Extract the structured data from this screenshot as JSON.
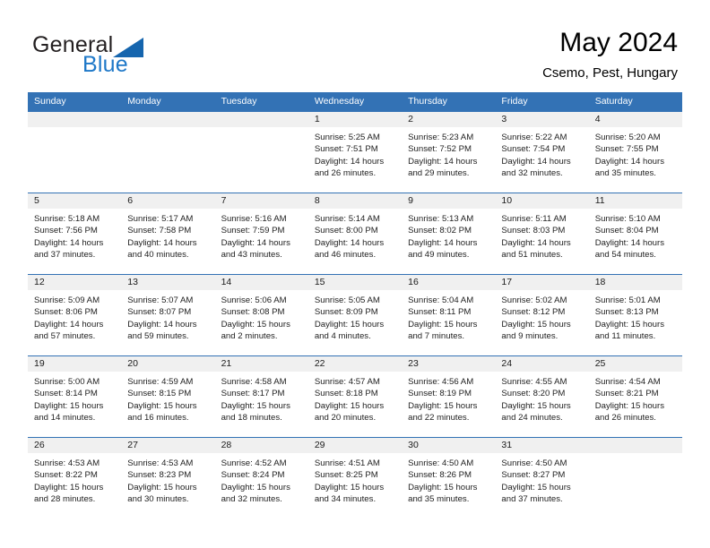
{
  "brand": {
    "name_part1": "General",
    "name_part2": "Blue",
    "logo_icon": "triangle-logo-icon"
  },
  "header": {
    "title": "May 2024",
    "location": "Csemo, Pest, Hungary"
  },
  "colors": {
    "header_blue": "#3372b5",
    "brand_blue": "#1e78c8",
    "logo_blue": "#1565ae",
    "daynum_band": "#f0f0f0"
  },
  "weekdays": [
    "Sunday",
    "Monday",
    "Tuesday",
    "Wednesday",
    "Thursday",
    "Friday",
    "Saturday"
  ],
  "weeks": [
    [
      {
        "day": "",
        "sunrise": "",
        "sunset": "",
        "daylight_line1": "",
        "daylight_line2": "",
        "empty": true
      },
      {
        "day": "",
        "sunrise": "",
        "sunset": "",
        "daylight_line1": "",
        "daylight_line2": "",
        "empty": true
      },
      {
        "day": "",
        "sunrise": "",
        "sunset": "",
        "daylight_line1": "",
        "daylight_line2": "",
        "empty": true
      },
      {
        "day": "1",
        "sunrise": "Sunrise: 5:25 AM",
        "sunset": "Sunset: 7:51 PM",
        "daylight_line1": "Daylight: 14 hours",
        "daylight_line2": "and 26 minutes.",
        "empty": false
      },
      {
        "day": "2",
        "sunrise": "Sunrise: 5:23 AM",
        "sunset": "Sunset: 7:52 PM",
        "daylight_line1": "Daylight: 14 hours",
        "daylight_line2": "and 29 minutes.",
        "empty": false
      },
      {
        "day": "3",
        "sunrise": "Sunrise: 5:22 AM",
        "sunset": "Sunset: 7:54 PM",
        "daylight_line1": "Daylight: 14 hours",
        "daylight_line2": "and 32 minutes.",
        "empty": false
      },
      {
        "day": "4",
        "sunrise": "Sunrise: 5:20 AM",
        "sunset": "Sunset: 7:55 PM",
        "daylight_line1": "Daylight: 14 hours",
        "daylight_line2": "and 35 minutes.",
        "empty": false
      }
    ],
    [
      {
        "day": "5",
        "sunrise": "Sunrise: 5:18 AM",
        "sunset": "Sunset: 7:56 PM",
        "daylight_line1": "Daylight: 14 hours",
        "daylight_line2": "and 37 minutes.",
        "empty": false
      },
      {
        "day": "6",
        "sunrise": "Sunrise: 5:17 AM",
        "sunset": "Sunset: 7:58 PM",
        "daylight_line1": "Daylight: 14 hours",
        "daylight_line2": "and 40 minutes.",
        "empty": false
      },
      {
        "day": "7",
        "sunrise": "Sunrise: 5:16 AM",
        "sunset": "Sunset: 7:59 PM",
        "daylight_line1": "Daylight: 14 hours",
        "daylight_line2": "and 43 minutes.",
        "empty": false
      },
      {
        "day": "8",
        "sunrise": "Sunrise: 5:14 AM",
        "sunset": "Sunset: 8:00 PM",
        "daylight_line1": "Daylight: 14 hours",
        "daylight_line2": "and 46 minutes.",
        "empty": false
      },
      {
        "day": "9",
        "sunrise": "Sunrise: 5:13 AM",
        "sunset": "Sunset: 8:02 PM",
        "daylight_line1": "Daylight: 14 hours",
        "daylight_line2": "and 49 minutes.",
        "empty": false
      },
      {
        "day": "10",
        "sunrise": "Sunrise: 5:11 AM",
        "sunset": "Sunset: 8:03 PM",
        "daylight_line1": "Daylight: 14 hours",
        "daylight_line2": "and 51 minutes.",
        "empty": false
      },
      {
        "day": "11",
        "sunrise": "Sunrise: 5:10 AM",
        "sunset": "Sunset: 8:04 PM",
        "daylight_line1": "Daylight: 14 hours",
        "daylight_line2": "and 54 minutes.",
        "empty": false
      }
    ],
    [
      {
        "day": "12",
        "sunrise": "Sunrise: 5:09 AM",
        "sunset": "Sunset: 8:06 PM",
        "daylight_line1": "Daylight: 14 hours",
        "daylight_line2": "and 57 minutes.",
        "empty": false
      },
      {
        "day": "13",
        "sunrise": "Sunrise: 5:07 AM",
        "sunset": "Sunset: 8:07 PM",
        "daylight_line1": "Daylight: 14 hours",
        "daylight_line2": "and 59 minutes.",
        "empty": false
      },
      {
        "day": "14",
        "sunrise": "Sunrise: 5:06 AM",
        "sunset": "Sunset: 8:08 PM",
        "daylight_line1": "Daylight: 15 hours",
        "daylight_line2": "and 2 minutes.",
        "empty": false
      },
      {
        "day": "15",
        "sunrise": "Sunrise: 5:05 AM",
        "sunset": "Sunset: 8:09 PM",
        "daylight_line1": "Daylight: 15 hours",
        "daylight_line2": "and 4 minutes.",
        "empty": false
      },
      {
        "day": "16",
        "sunrise": "Sunrise: 5:04 AM",
        "sunset": "Sunset: 8:11 PM",
        "daylight_line1": "Daylight: 15 hours",
        "daylight_line2": "and 7 minutes.",
        "empty": false
      },
      {
        "day": "17",
        "sunrise": "Sunrise: 5:02 AM",
        "sunset": "Sunset: 8:12 PM",
        "daylight_line1": "Daylight: 15 hours",
        "daylight_line2": "and 9 minutes.",
        "empty": false
      },
      {
        "day": "18",
        "sunrise": "Sunrise: 5:01 AM",
        "sunset": "Sunset: 8:13 PM",
        "daylight_line1": "Daylight: 15 hours",
        "daylight_line2": "and 11 minutes.",
        "empty": false
      }
    ],
    [
      {
        "day": "19",
        "sunrise": "Sunrise: 5:00 AM",
        "sunset": "Sunset: 8:14 PM",
        "daylight_line1": "Daylight: 15 hours",
        "daylight_line2": "and 14 minutes.",
        "empty": false
      },
      {
        "day": "20",
        "sunrise": "Sunrise: 4:59 AM",
        "sunset": "Sunset: 8:15 PM",
        "daylight_line1": "Daylight: 15 hours",
        "daylight_line2": "and 16 minutes.",
        "empty": false
      },
      {
        "day": "21",
        "sunrise": "Sunrise: 4:58 AM",
        "sunset": "Sunset: 8:17 PM",
        "daylight_line1": "Daylight: 15 hours",
        "daylight_line2": "and 18 minutes.",
        "empty": false
      },
      {
        "day": "22",
        "sunrise": "Sunrise: 4:57 AM",
        "sunset": "Sunset: 8:18 PM",
        "daylight_line1": "Daylight: 15 hours",
        "daylight_line2": "and 20 minutes.",
        "empty": false
      },
      {
        "day": "23",
        "sunrise": "Sunrise: 4:56 AM",
        "sunset": "Sunset: 8:19 PM",
        "daylight_line1": "Daylight: 15 hours",
        "daylight_line2": "and 22 minutes.",
        "empty": false
      },
      {
        "day": "24",
        "sunrise": "Sunrise: 4:55 AM",
        "sunset": "Sunset: 8:20 PM",
        "daylight_line1": "Daylight: 15 hours",
        "daylight_line2": "and 24 minutes.",
        "empty": false
      },
      {
        "day": "25",
        "sunrise": "Sunrise: 4:54 AM",
        "sunset": "Sunset: 8:21 PM",
        "daylight_line1": "Daylight: 15 hours",
        "daylight_line2": "and 26 minutes.",
        "empty": false
      }
    ],
    [
      {
        "day": "26",
        "sunrise": "Sunrise: 4:53 AM",
        "sunset": "Sunset: 8:22 PM",
        "daylight_line1": "Daylight: 15 hours",
        "daylight_line2": "and 28 minutes.",
        "empty": false
      },
      {
        "day": "27",
        "sunrise": "Sunrise: 4:53 AM",
        "sunset": "Sunset: 8:23 PM",
        "daylight_line1": "Daylight: 15 hours",
        "daylight_line2": "and 30 minutes.",
        "empty": false
      },
      {
        "day": "28",
        "sunrise": "Sunrise: 4:52 AM",
        "sunset": "Sunset: 8:24 PM",
        "daylight_line1": "Daylight: 15 hours",
        "daylight_line2": "and 32 minutes.",
        "empty": false
      },
      {
        "day": "29",
        "sunrise": "Sunrise: 4:51 AM",
        "sunset": "Sunset: 8:25 PM",
        "daylight_line1": "Daylight: 15 hours",
        "daylight_line2": "and 34 minutes.",
        "empty": false
      },
      {
        "day": "30",
        "sunrise": "Sunrise: 4:50 AM",
        "sunset": "Sunset: 8:26 PM",
        "daylight_line1": "Daylight: 15 hours",
        "daylight_line2": "and 35 minutes.",
        "empty": false
      },
      {
        "day": "31",
        "sunrise": "Sunrise: 4:50 AM",
        "sunset": "Sunset: 8:27 PM",
        "daylight_line1": "Daylight: 15 hours",
        "daylight_line2": "and 37 minutes.",
        "empty": false
      },
      {
        "day": "",
        "sunrise": "",
        "sunset": "",
        "daylight_line1": "",
        "daylight_line2": "",
        "empty": true
      }
    ]
  ]
}
